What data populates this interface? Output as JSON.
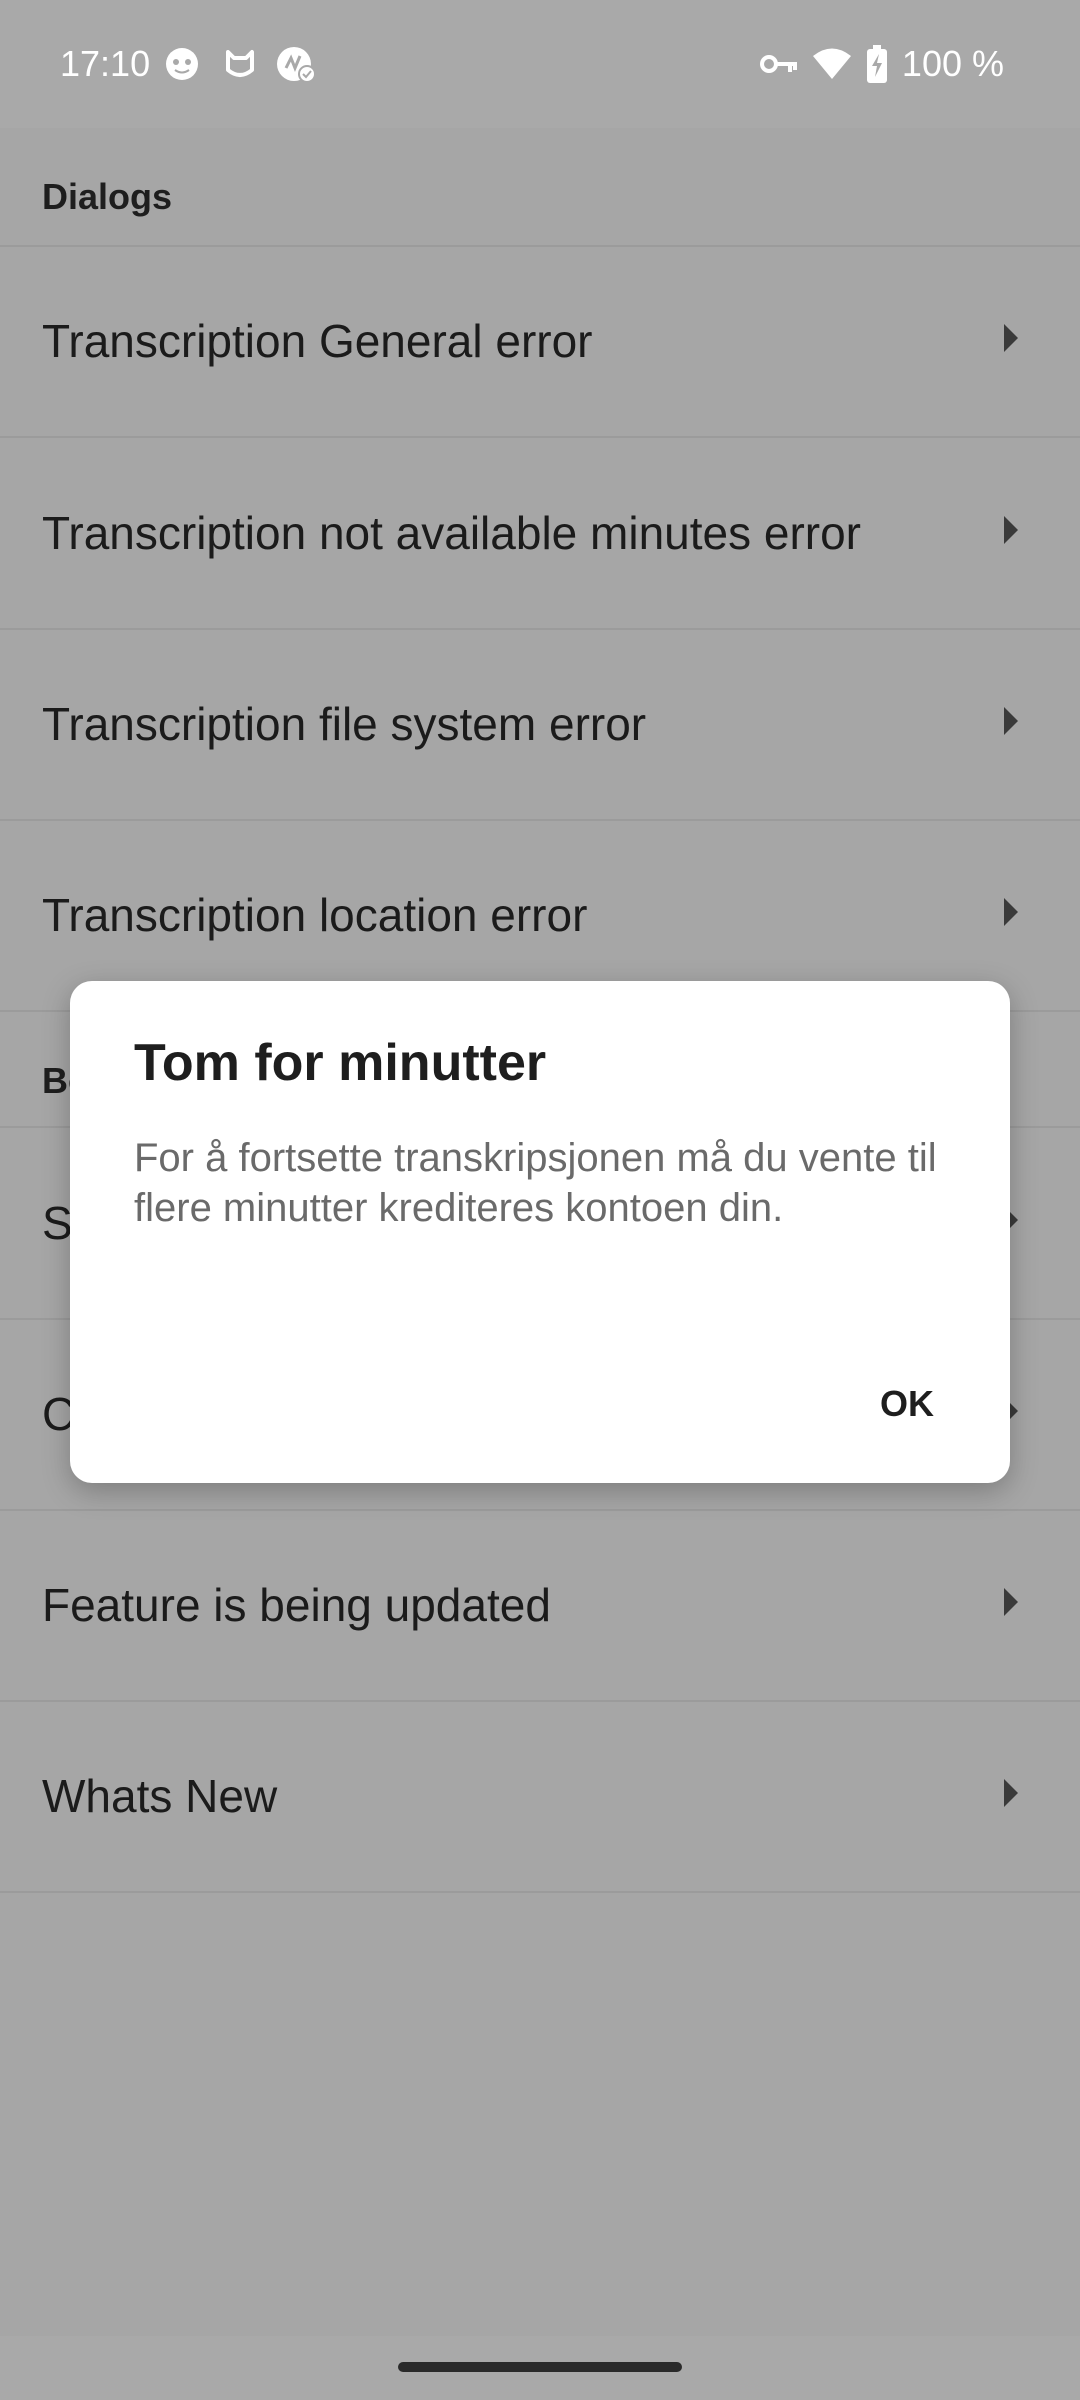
{
  "status_bar": {
    "time": "17:10",
    "notification_icons": [
      "cat-face-icon",
      "cat-outline-icon",
      "app-check-icon"
    ],
    "system_icons": [
      "vpn-key-icon",
      "wifi-icon",
      "battery-charging-icon"
    ],
    "battery_text": "100 %"
  },
  "sections": [
    {
      "header": "Dialogs",
      "items": [
        {
          "label": "Transcription General error"
        },
        {
          "label": "Transcription not available minutes error"
        },
        {
          "label": "Transcription file system error"
        },
        {
          "label": "Transcription location error"
        }
      ]
    },
    {
      "header": "Bo",
      "items": [
        {
          "label": "S"
        },
        {
          "label": "C"
        },
        {
          "label": "Feature is being updated"
        },
        {
          "label": "Whats New"
        }
      ]
    }
  ],
  "dialog": {
    "title": "Tom for minutter",
    "message": "For å fortsette transkripsjonen må du vente til flere minutter krediteres kontoen din.",
    "ok_label": "OK"
  },
  "colors": {
    "scrim_background": "#a6a6a6",
    "dialog_background": "#ffffff",
    "text_primary": "#1c1c1c",
    "text_secondary": "#6a6a6a"
  }
}
